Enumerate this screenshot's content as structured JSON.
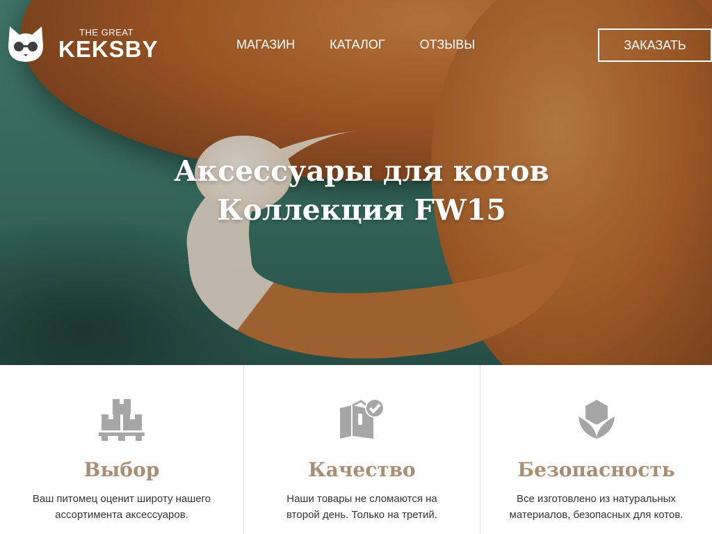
{
  "logo": {
    "small": "THE GREAT",
    "big": "KEKSBY"
  },
  "nav": {
    "items": [
      "МАГАЗИН",
      "КАТАЛОГ",
      "ОТЗЫВЫ"
    ]
  },
  "order_button": "ЗАКАЗАТЬ",
  "hero": {
    "title_line1": "Аксессуары для котов",
    "title_line2": "Коллекция FW15"
  },
  "features": [
    {
      "title": "Выбор",
      "line1": "Ваш питомец оценит широту нашего",
      "line2": "ассортимента аксессуаров.",
      "icon": "boxes-icon"
    },
    {
      "title": "Качество",
      "line1": "Наши товары не сломаются на",
      "line2": "второй день. Только на третий.",
      "icon": "box-check-icon"
    },
    {
      "title": "Безопасность",
      "line1": "Все изготовлено из натуральных",
      "line2": "материалов, безопасных для котов.",
      "icon": "lotus-icon"
    }
  ],
  "colors": {
    "accent": "#a88e73",
    "icon": "#a6a6a6",
    "hero_green": "#3f7b6b"
  }
}
